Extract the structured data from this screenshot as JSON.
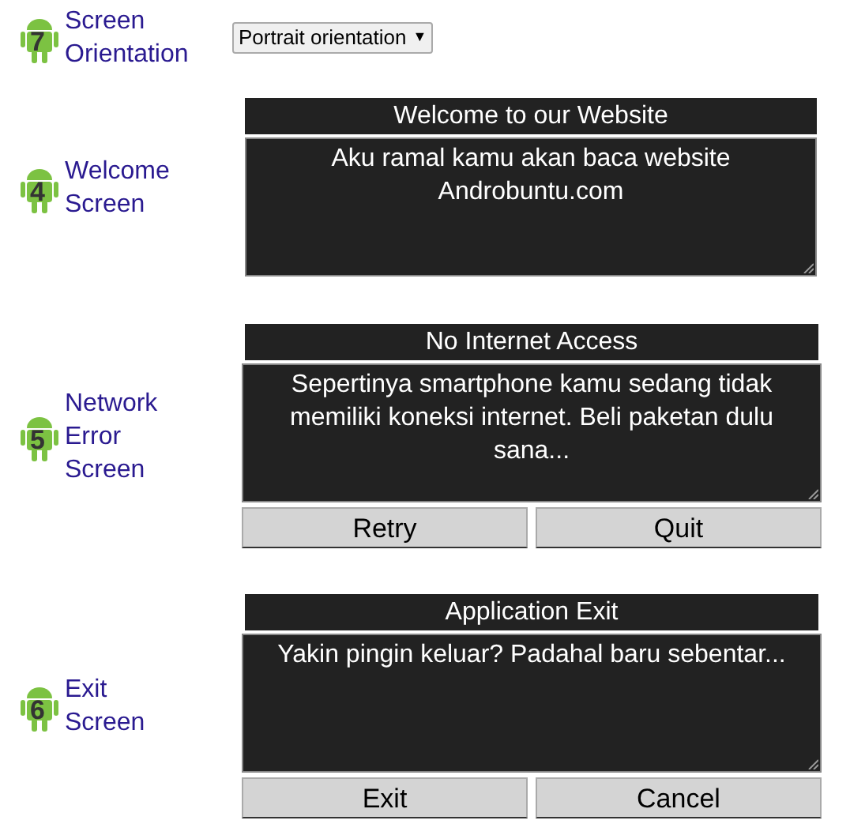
{
  "sections": [
    {
      "kind": "select",
      "badge": "7",
      "label": [
        "Screen",
        "Orientation"
      ],
      "value": "Portrait orientation",
      "caret": "▼"
    },
    {
      "kind": "dialog",
      "badge": "4",
      "label": [
        "Welcome",
        "Screen"
      ],
      "title": "Welcome to our Website",
      "message": "Aku ramal kamu akan baca website Androbuntu.com"
    },
    {
      "kind": "dialog",
      "badge": "5",
      "label": [
        "Network",
        "Error",
        "Screen"
      ],
      "title": "No Internet Access",
      "message": "Sepertinya smartphone kamu sedang tidak memiliki koneksi internet. Beli paketan dulu sana...",
      "buttons": [
        "Retry",
        "Quit"
      ]
    },
    {
      "kind": "dialog",
      "badge": "6",
      "label": [
        "Exit",
        "Screen"
      ],
      "title": "Application Exit",
      "message": "Yakin pingin keluar? Padahal baru sebentar...",
      "buttons": [
        "Exit",
        "Cancel"
      ]
    }
  ]
}
